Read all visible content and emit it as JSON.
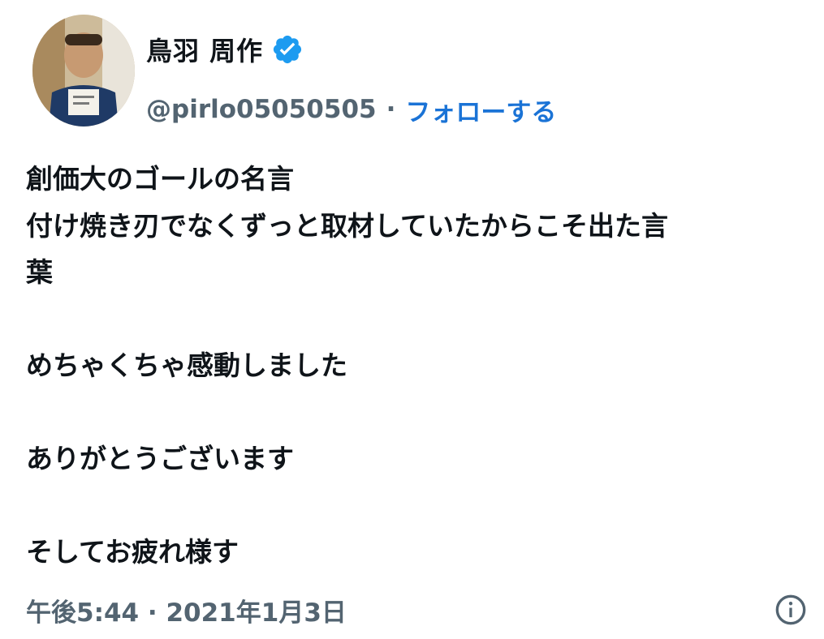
{
  "author": {
    "display_name": "鳥羽 周作",
    "handle": "@pirlo05050505",
    "separator": "·",
    "follow_label": "フォローする",
    "verified": true,
    "accent_color": "#1a73d6",
    "verified_color": "#1d9bf0"
  },
  "tweet": {
    "lines": [
      "創価大のゴールの名言",
      "付け焼き刃でなくずっと取材していたからこそ出た言",
      "葉",
      "",
      "めちゃくちゃ感動しました",
      "",
      "ありがとうございます",
      "",
      "そしてお疲れ様す"
    ]
  },
  "footer": {
    "timestamp": "午後5:44 · 2021年1月3日",
    "info_icon": "info-icon"
  }
}
